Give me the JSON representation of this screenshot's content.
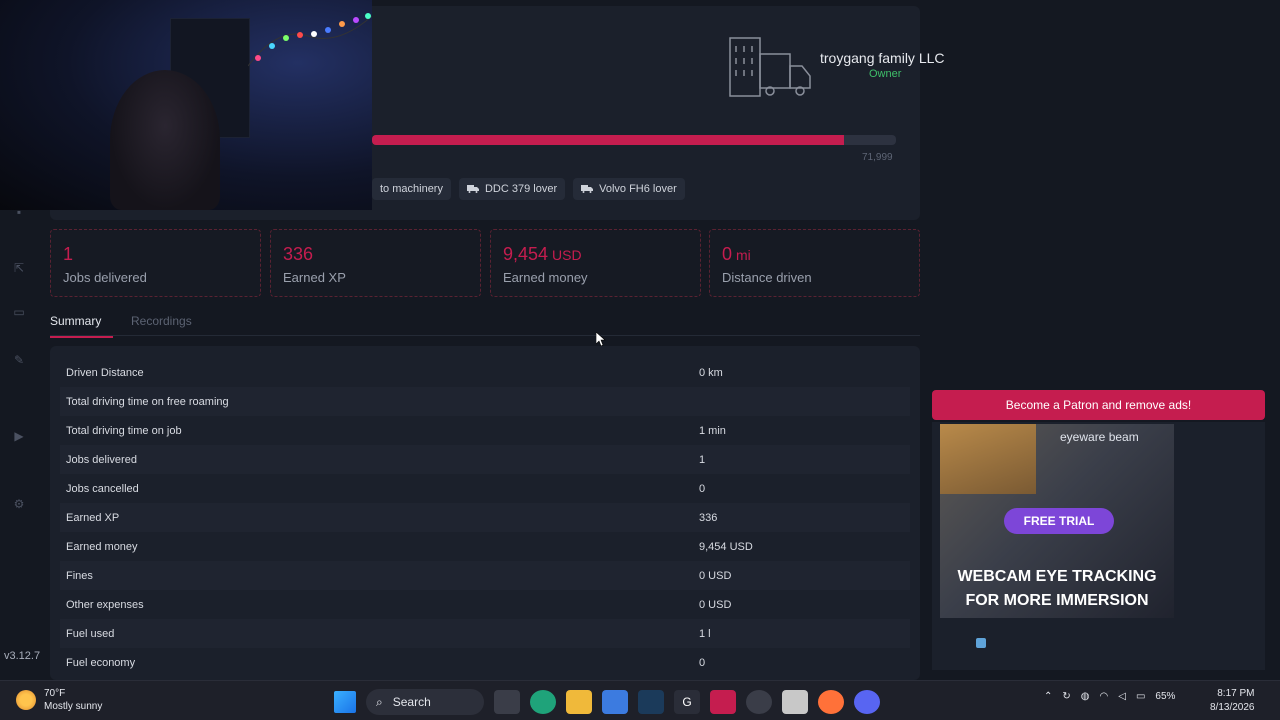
{
  "app": {
    "version": "v3.12.7"
  },
  "company": {
    "name": "troygang family LLC",
    "role": "Owner"
  },
  "xp": {
    "max_label": "71,999",
    "progress": 0.9
  },
  "tags": [
    {
      "label": "to machinery"
    },
    {
      "label": "DDC 379 lover"
    },
    {
      "label": "Volvo FH6 lover"
    }
  ],
  "stats": [
    {
      "value": "1",
      "unit": "",
      "label": "Jobs delivered"
    },
    {
      "value": "336",
      "unit": "",
      "label": "Earned XP"
    },
    {
      "value": "9,454",
      "unit": "USD",
      "label": "Earned money"
    },
    {
      "value": "0",
      "unit": "mi",
      "label": "Distance driven"
    }
  ],
  "tabs": [
    {
      "label": "Summary",
      "active": true
    },
    {
      "label": "Recordings",
      "active": false
    }
  ],
  "summary_rows": [
    {
      "key": "Driven Distance",
      "value": "0 km"
    },
    {
      "key": "Total driving time on free roaming",
      "value": ""
    },
    {
      "key": "Total driving time on job",
      "value": "1 min"
    },
    {
      "key": "Jobs delivered",
      "value": "1"
    },
    {
      "key": "Jobs cancelled",
      "value": "0"
    },
    {
      "key": "Earned XP",
      "value": "336"
    },
    {
      "key": "Earned money",
      "value": "9,454 USD"
    },
    {
      "key": "Fines",
      "value": "0 USD"
    },
    {
      "key": "Other expenses",
      "value": "0 USD"
    },
    {
      "key": "Fuel used",
      "value": "1 l"
    },
    {
      "key": "Fuel economy",
      "value": "0"
    }
  ],
  "ad": {
    "header": "Become a Patron and remove ads!",
    "brand": "eyeware beam",
    "cta": "FREE TRIAL",
    "headline_1": "WEBCAM EYE TRACKING",
    "headline_2": "FOR MORE IMMERSION"
  },
  "taskbar": {
    "temperature": "70°F",
    "weather": "Mostly sunny",
    "search_label": "Search",
    "battery": "65%",
    "time": "8:17 PM",
    "date": "8/13/2026"
  },
  "colors": {
    "accent": "#c51d4f",
    "owner": "#3fbf6a",
    "background": "#141821",
    "panel": "#1b202b"
  }
}
